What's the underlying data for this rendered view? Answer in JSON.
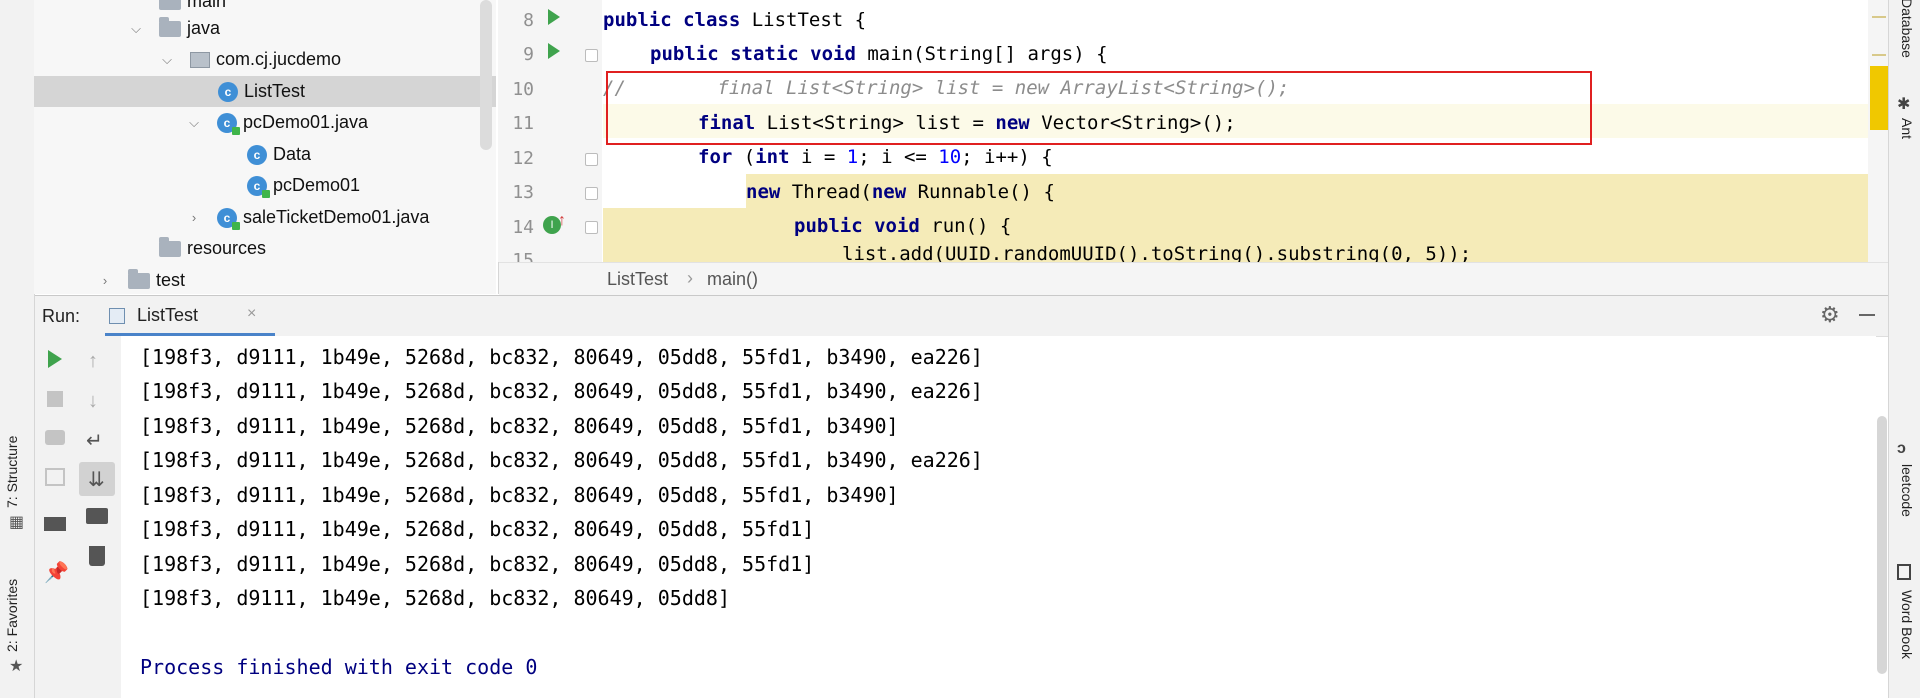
{
  "project_tree": {
    "items": [
      {
        "label": "main",
        "type": "folder"
      },
      {
        "label": "java",
        "type": "folder"
      },
      {
        "label": "com.cj.jucdemo",
        "type": "package"
      },
      {
        "label": "ListTest",
        "type": "class",
        "selected": true
      },
      {
        "label": "pcDemo01.java",
        "type": "class-file"
      },
      {
        "label": "Data",
        "type": "class"
      },
      {
        "label": "pcDemo01",
        "type": "class-run"
      },
      {
        "label": "saleTicketDemo01.java",
        "type": "class-file"
      },
      {
        "label": "resources",
        "type": "folder"
      },
      {
        "label": "test",
        "type": "folder"
      }
    ]
  },
  "editor": {
    "line_numbers": [
      "8",
      "9",
      "10",
      "11",
      "12",
      "13",
      "14",
      "15"
    ],
    "lines": {
      "l8_kw": "public class",
      "l8_rest": " ListTest {",
      "l9_kw": "public static void",
      "l9_rest": " main(String[] args) {",
      "l10_comment": "//        final List<String> list = new ArrayList<String>();",
      "l11_kw1": "final",
      "l11_mid": " List<String> list = ",
      "l11_kw2": "new",
      "l11_rest": " Vector<String>();",
      "l12_kw1": "for",
      "l12_a": " (",
      "l12_kw2": "int",
      "l12_b": " i = ",
      "l12_n1": "1",
      "l12_c": "; i <= ",
      "l12_n2": "10",
      "l12_d": "; i++) {",
      "l13_kw1": "new",
      "l13_a": " Thread(",
      "l13_kw2": "new",
      "l13_b": " Runnable() {",
      "l14_kw": "public void",
      "l14_rest": " run() {",
      "l15_text": "list.add(UUID.randomUUID().toString().substring(0, 5));"
    },
    "highlight_color": "#f5ebb8",
    "current_line_color": "#fcfae8",
    "box_color": "#e02020"
  },
  "breadcrumb": {
    "file": "ListTest",
    "separator": "›",
    "method": "main()"
  },
  "run_panel": {
    "label": "Run:",
    "tab": "ListTest",
    "output": [
      "[198f3, d9111, 1b49e, 5268d, bc832, 80649, 05dd8, 55fd1, b3490, ea226]",
      "[198f3, d9111, 1b49e, 5268d, bc832, 80649, 05dd8, 55fd1, b3490, ea226]",
      "[198f3, d9111, 1b49e, 5268d, bc832, 80649, 05dd8, 55fd1, b3490]",
      "[198f3, d9111, 1b49e, 5268d, bc832, 80649, 05dd8, 55fd1, b3490, ea226]",
      "[198f3, d9111, 1b49e, 5268d, bc832, 80649, 05dd8, 55fd1, b3490]",
      "[198f3, d9111, 1b49e, 5268d, bc832, 80649, 05dd8, 55fd1]",
      "[198f3, d9111, 1b49e, 5268d, bc832, 80649, 05dd8, 55fd1]",
      "[198f3, d9111, 1b49e, 5268d, bc832, 80649, 05dd8]"
    ],
    "process_message": "Process finished with exit code 0",
    "process_color": "#000080"
  },
  "left_stripe": {
    "structure": "7: Structure",
    "favorites": "2: Favorites"
  },
  "right_stripe": {
    "database": "Database",
    "ant": "Ant",
    "leetcode": "leetcode",
    "wordbook": "Word Book"
  }
}
